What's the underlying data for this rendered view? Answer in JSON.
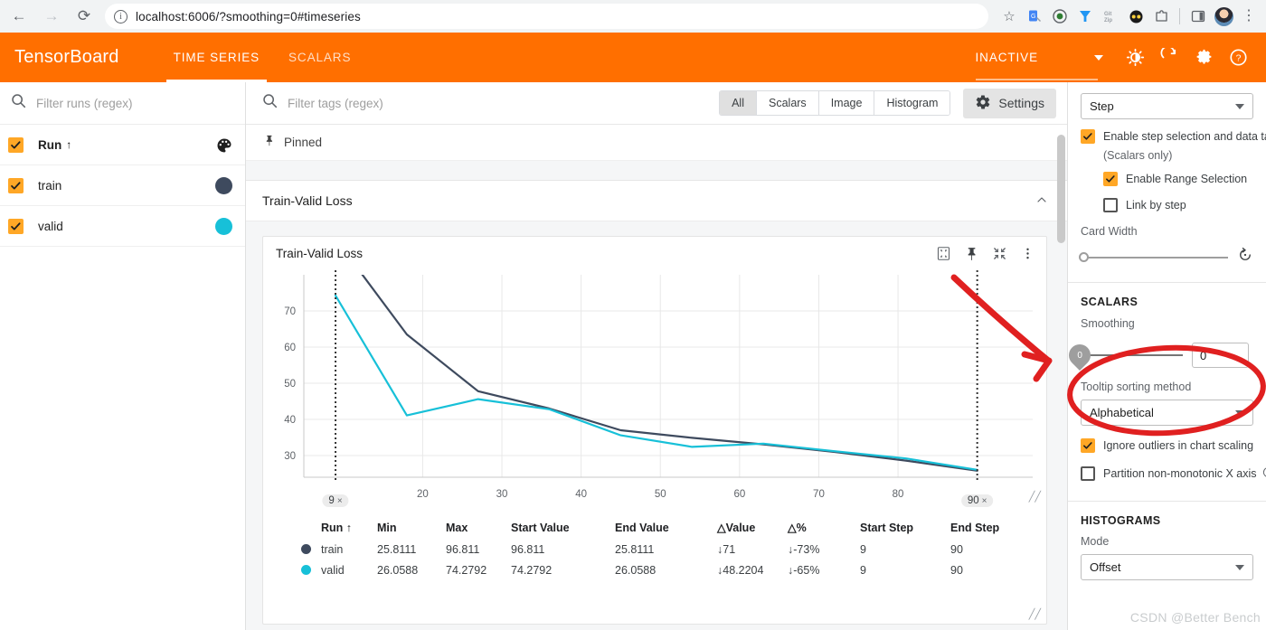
{
  "browser": {
    "url": "localhost:6006/?smoothing=0#timeseries",
    "back_icon": "back-arrow-icon",
    "forward_icon": "forward-arrow-icon",
    "reload_icon": "reload-icon",
    "info_icon": "site-info-icon",
    "star_icon": "bookmark-star-icon",
    "extensions": [
      "translate-icon",
      "record-icon",
      "y-icon",
      "gitzip-icon",
      "glasses-icon",
      "puzzle-icon",
      "sidepanel-icon"
    ],
    "menu_icon": "browser-menu-icon"
  },
  "header": {
    "logo": "TensorBoard",
    "tabs": [
      {
        "label": "TIME SERIES",
        "active": true
      },
      {
        "label": "SCALARS",
        "active": false
      }
    ],
    "status": "INACTIVE",
    "brightness_icon": "brightness-icon",
    "reload_icon": "refresh-icon",
    "settings_icon": "gear-icon",
    "help_icon": "help-icon",
    "accent": "#ff6f00"
  },
  "runs_panel": {
    "filter_placeholder": "Filter runs (regex)",
    "filter_value": "",
    "header_row": {
      "label": "Run",
      "sort": "↑",
      "checked": true,
      "palette_icon": "color-palette-icon"
    },
    "runs": [
      {
        "label": "train",
        "checked": true,
        "color": "#3e4a5e"
      },
      {
        "label": "valid",
        "checked": true,
        "color": "#17c0d8"
      }
    ]
  },
  "tags_bar": {
    "placeholder": "Filter tags (regex)",
    "value": "",
    "chips": [
      {
        "label": "All",
        "selected": true
      },
      {
        "label": "Scalars",
        "selected": false
      },
      {
        "label": "Image",
        "selected": false
      },
      {
        "label": "Histogram",
        "selected": false
      }
    ],
    "settings_label": "Settings",
    "settings_icon": "gear-icon"
  },
  "pinned": {
    "label": "Pinned",
    "icon": "pin-icon"
  },
  "group": {
    "title": "Train-Valid Loss",
    "collapse_icon": "chevron-up-icon"
  },
  "card": {
    "title": "Train-Valid Loss",
    "actions": [
      "fullscreen-icon",
      "pin-icon",
      "fit-icon",
      "more-vert-icon"
    ]
  },
  "chart_data": {
    "type": "line",
    "title": "Train-Valid Loss",
    "xlabel": "",
    "ylabel": "",
    "xlim": [
      5,
      97
    ],
    "ylim": [
      24,
      80
    ],
    "xticks": [
      20,
      30,
      40,
      50,
      60,
      70,
      80
    ],
    "yticks": [
      30,
      40,
      50,
      60,
      70
    ],
    "grid": true,
    "legend": "none",
    "range_markers": [
      {
        "step": 9,
        "label": "9",
        "close": "×"
      },
      {
        "step": 90,
        "label": "90",
        "close": "×"
      }
    ],
    "series": [
      {
        "name": "train",
        "color": "#3e4a5e",
        "x": [
          9,
          18,
          27,
          36,
          45,
          54,
          63,
          72,
          81,
          90
        ],
        "values": [
          96.811,
          63.5,
          47.8,
          43.0,
          37.0,
          34.9,
          33.1,
          31.0,
          28.6,
          25.8111
        ]
      },
      {
        "name": "valid",
        "color": "#17c0d8",
        "x": [
          9,
          18,
          27,
          36,
          45,
          54,
          63,
          72,
          81,
          90
        ],
        "values": [
          74.2792,
          41.1,
          45.6,
          42.8,
          35.6,
          32.4,
          33.3,
          31.2,
          29.2,
          26.0588
        ]
      }
    ]
  },
  "data_table": {
    "columns": [
      "Run ↑",
      "Min",
      "Max",
      "Start Value",
      "End Value",
      "△Value",
      "△%",
      "Start Step",
      "End Step"
    ],
    "rows": [
      {
        "run": "train",
        "color": "#3e4a5e",
        "min": "25.8111",
        "max": "96.811",
        "start_value": "96.811",
        "end_value": "25.8111",
        "delta_value": "71",
        "delta_value_dir": "↓",
        "delta_pct": "-73%",
        "delta_pct_dir": "↓",
        "start_step": "9",
        "end_step": "90"
      },
      {
        "run": "valid",
        "color": "#17c0d8",
        "min": "26.0588",
        "max": "74.2792",
        "start_value": "74.2792",
        "end_value": "26.0588",
        "delta_value": "48.2204",
        "delta_value_dir": "↓",
        "delta_pct": "-65%",
        "delta_pct_dir": "↓",
        "start_step": "9",
        "end_step": "90"
      }
    ]
  },
  "settings_panel": {
    "step_select": "Step",
    "enable_step_selection": {
      "label": "Enable step selection and data table",
      "checked": true
    },
    "scalars_only_note": "(Scalars only)",
    "enable_range_selection": {
      "label": "Enable Range Selection",
      "checked": true
    },
    "link_by_step": {
      "label": "Link by step",
      "checked": false
    },
    "card_width_label": "Card Width",
    "card_width_reset_icon": "restore-icon",
    "scalars_section": "SCALARS",
    "smoothing_label": "Smoothing",
    "smoothing_value": "0",
    "tooltip_sorting_label": "Tooltip sorting method",
    "tooltip_sorting_value": "Alphabetical",
    "ignore_outliers": {
      "label": "Ignore outliers in chart scaling",
      "checked": true
    },
    "partition_x": {
      "label": "Partition non-monotonic X axis",
      "checked": false,
      "help_icon": "help-icon"
    },
    "histograms_section": "HISTOGRAMS",
    "mode_label": "Mode",
    "mode_value": "Offset"
  },
  "watermark": "CSDN @Better Bench"
}
